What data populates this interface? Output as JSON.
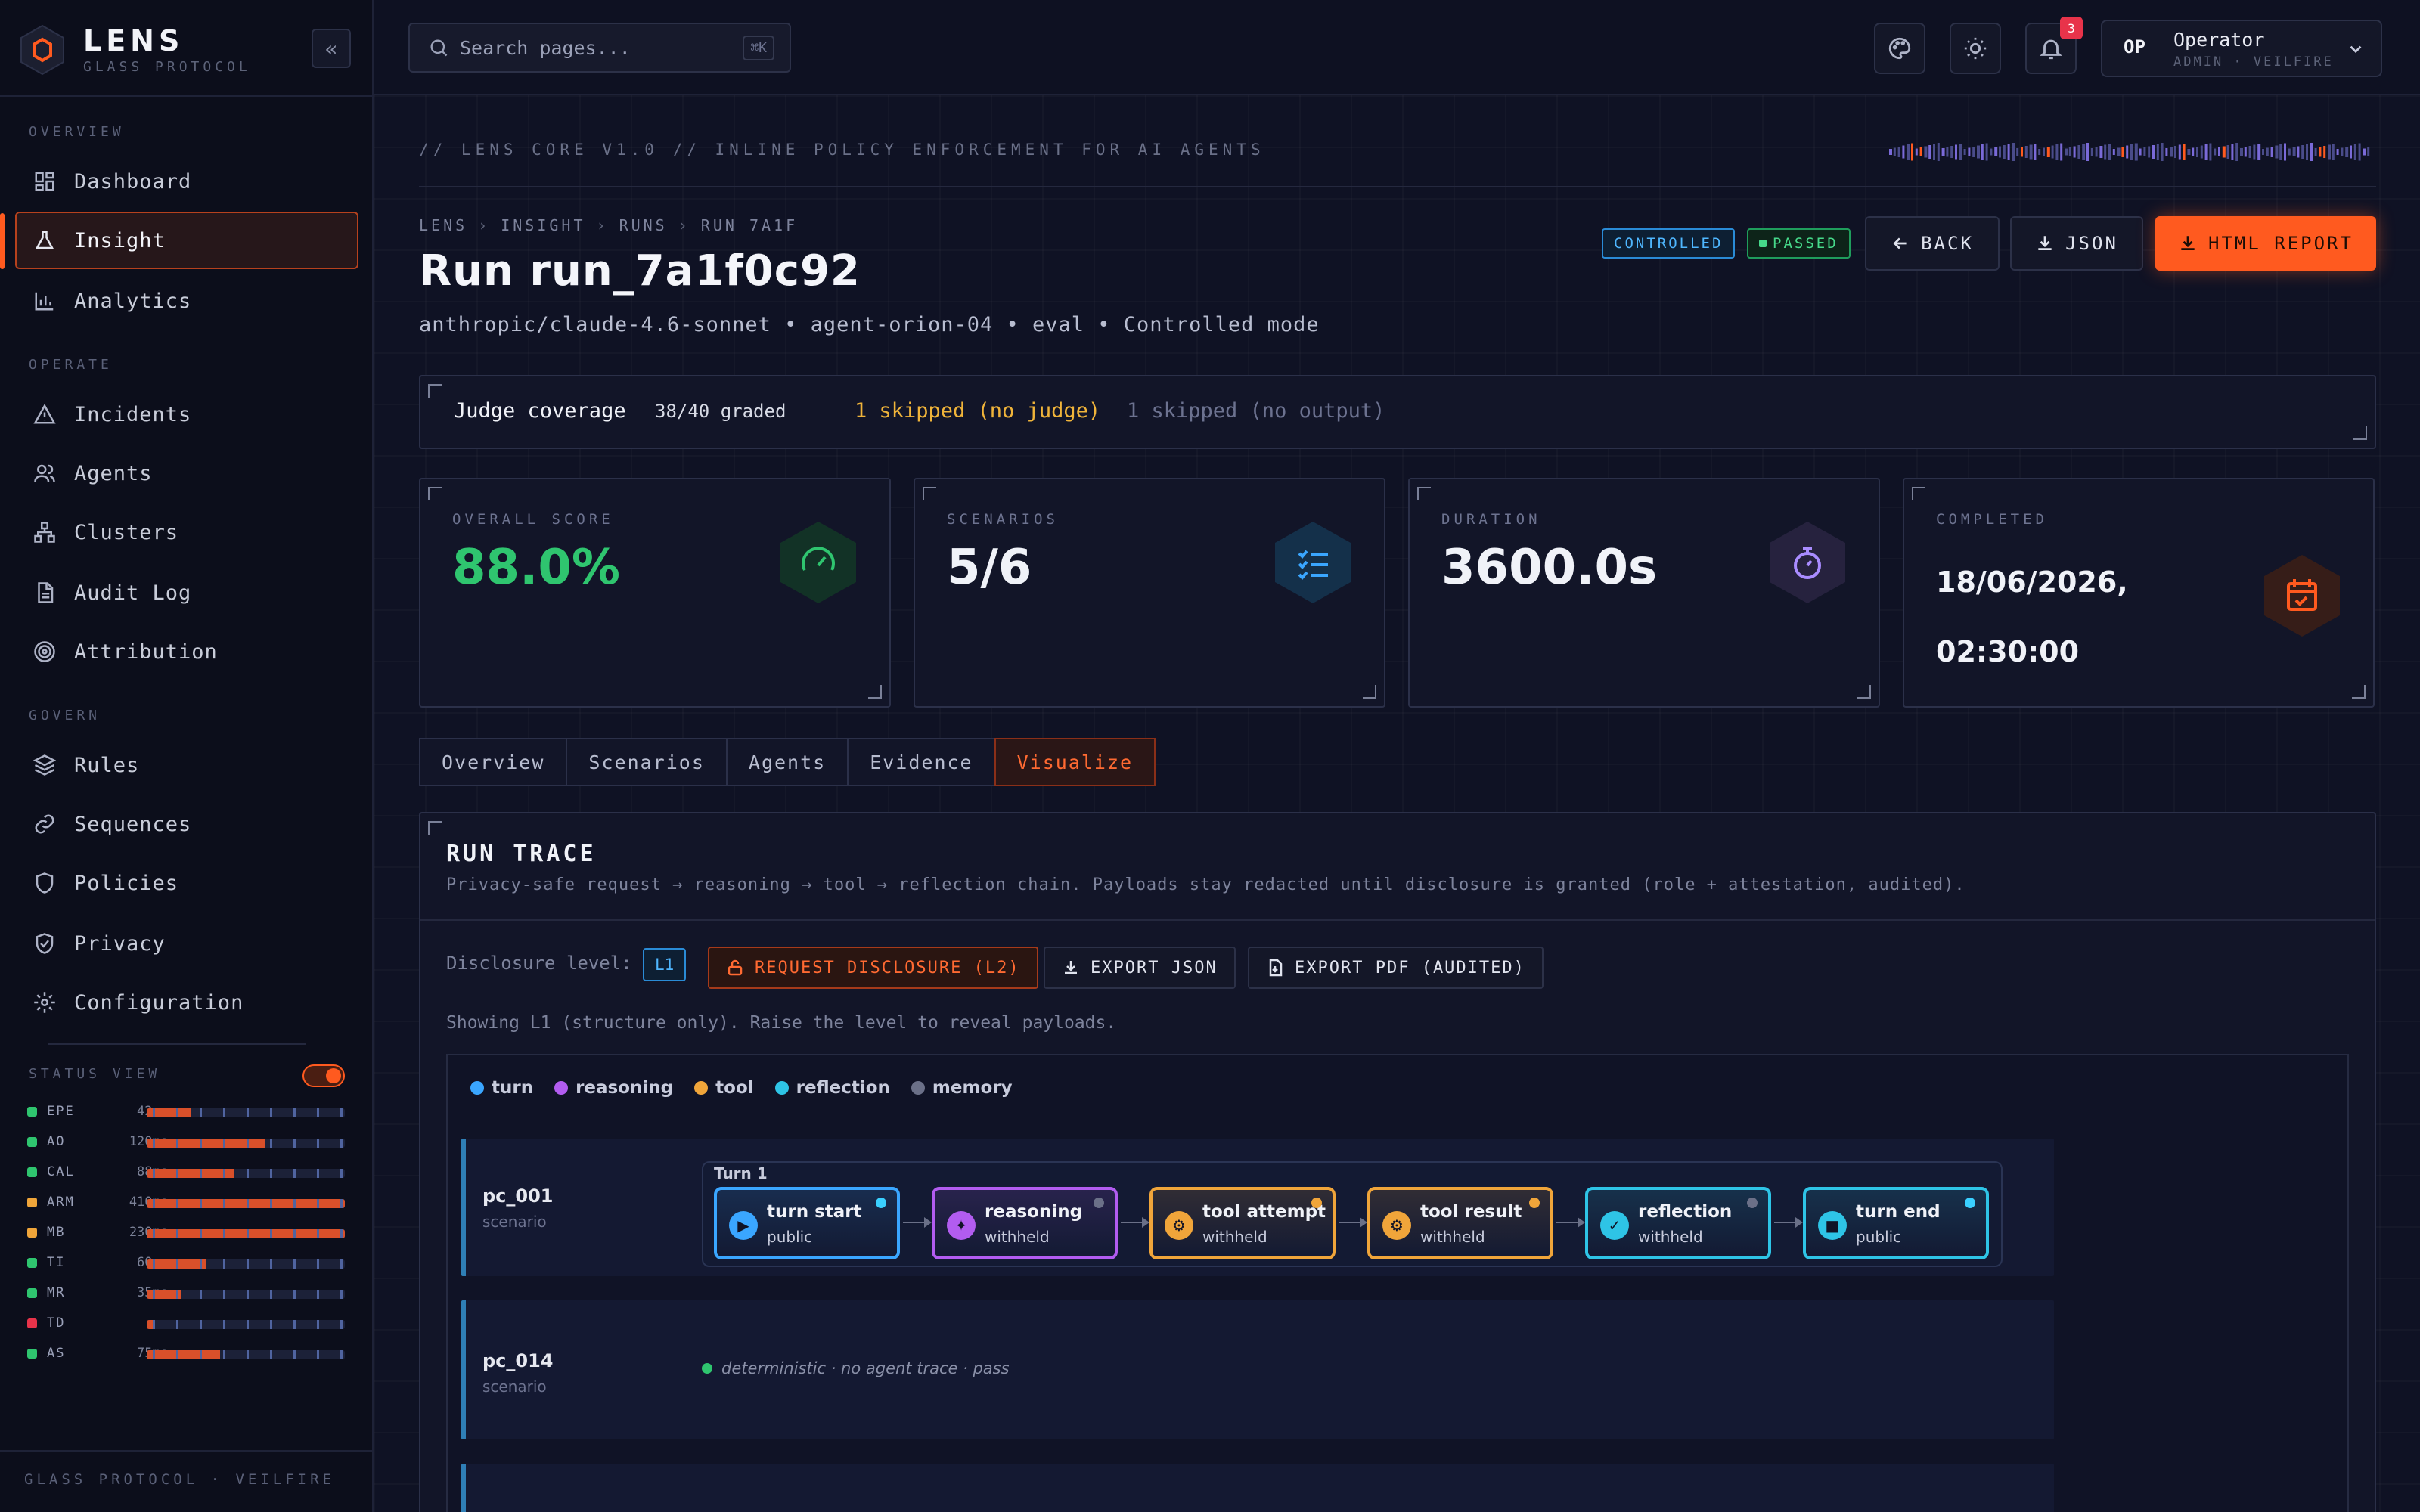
{
  "brand": {
    "name": "LENS",
    "sub": "GLASS PROTOCOL"
  },
  "sidebar": {
    "sections": [
      {
        "label": "OVERVIEW"
      },
      {
        "label": "OPERATE"
      },
      {
        "label": "GOVERN"
      }
    ],
    "items": [
      {
        "label": "Dashboard",
        "icon": "dashboard-icon"
      },
      {
        "label": "Insight",
        "icon": "flask-icon",
        "active": true
      },
      {
        "label": "Analytics",
        "icon": "bar-chart-icon"
      },
      {
        "label": "Incidents",
        "icon": "warning-icon"
      },
      {
        "label": "Agents",
        "icon": "users-icon"
      },
      {
        "label": "Clusters",
        "icon": "network-icon"
      },
      {
        "label": "Audit Log",
        "icon": "document-icon"
      },
      {
        "label": "Attribution",
        "icon": "target-icon"
      },
      {
        "label": "Rules",
        "icon": "layers-icon"
      },
      {
        "label": "Sequences",
        "icon": "link-icon"
      },
      {
        "label": "Policies",
        "icon": "shield-icon"
      },
      {
        "label": "Privacy",
        "icon": "shield-check-icon"
      },
      {
        "label": "Configuration",
        "icon": "gear-icon"
      }
    ],
    "status_view": {
      "label": "STATUS VIEW",
      "enabled": true,
      "rows": [
        {
          "code": "EPE",
          "latency": "42ms",
          "status": "ok",
          "color": "#2fc56f",
          "load": 0.22
        },
        {
          "code": "AO",
          "latency": "120ms",
          "status": "ok",
          "color": "#2fc56f",
          "load": 0.6
        },
        {
          "code": "CAL",
          "latency": "88ms",
          "status": "ok",
          "color": "#2fc56f",
          "load": 0.44
        },
        {
          "code": "ARM",
          "latency": "410ms",
          "status": "warn",
          "color": "#f0a53a",
          "load": 1.0
        },
        {
          "code": "MB",
          "latency": "230ms",
          "status": "warn",
          "color": "#f0a53a",
          "load": 1.0
        },
        {
          "code": "TI",
          "latency": "60ms",
          "status": "ok",
          "color": "#2fc56f",
          "load": 0.3
        },
        {
          "code": "MR",
          "latency": "35ms",
          "status": "ok",
          "color": "#2fc56f",
          "load": 0.17
        },
        {
          "code": "TD",
          "latency": "—",
          "status": "down",
          "color": "#e8334a",
          "load": 0.03
        },
        {
          "code": "AS",
          "latency": "75ms",
          "status": "ok",
          "color": "#2fc56f",
          "load": 0.37
        }
      ]
    },
    "footer": "GLASS PROTOCOL · VEILFIRE"
  },
  "header": {
    "search_placeholder": "Search pages...",
    "search_shortcut": "⌘K",
    "notifications_count": "3",
    "user": {
      "initials": "OP",
      "name": "Operator",
      "role": "ADMIN · VEILFIRE"
    }
  },
  "main": {
    "tagline": "// LENS CORE V1.0  //  INLINE POLICY ENFORCEMENT FOR AI AGENTS",
    "breadcrumb": [
      "LENS",
      "INSIGHT",
      "RUNS",
      "RUN_7A1F"
    ],
    "title": "Run run_7a1f0c92",
    "meta": "anthropic/claude-4.6-sonnet • agent-orion-04 • eval • Controlled mode",
    "badges": {
      "mode": "CONTROLLED",
      "result": "PASSED"
    },
    "actions": {
      "back": "BACK",
      "json": "JSON",
      "report": "HTML REPORT"
    },
    "coverage": {
      "label": "Judge coverage",
      "graded": "38/40 graded",
      "skipped_judge": "1 skipped (no judge)",
      "skipped_output": "1 skipped (no output)"
    },
    "stats": [
      {
        "label": "OVERALL SCORE",
        "value": "88.0%",
        "icon": "gauge-icon",
        "accent": "#2fc56f"
      },
      {
        "label": "SCENARIOS",
        "value": "5/6",
        "icon": "checklist-icon",
        "accent": "#3aa6ff"
      },
      {
        "label": "DURATION",
        "value": "3600.0s",
        "icon": "stopwatch-icon",
        "accent": "#a98cff"
      },
      {
        "label": "COMPLETED",
        "value": "18/06/2026,",
        "value2": "02:30:00",
        "icon": "calendar-icon",
        "accent": "#ff5a1f"
      }
    ],
    "tabs": [
      "Overview",
      "Scenarios",
      "Agents",
      "Evidence",
      "Visualize"
    ],
    "active_tab": "Visualize",
    "trace": {
      "title": "RUN TRACE",
      "subtitle": "Privacy-safe request → reasoning → tool → reflection chain. Payloads stay redacted until disclosure is granted (role + attestation, audited).",
      "disclosure_label": "Disclosure level:",
      "disclosure_level": "L1",
      "request_btn": "REQUEST DISCLOSURE (L2)",
      "export_json_btn": "EXPORT JSON",
      "export_pdf_btn": "EXPORT PDF (AUDITED)",
      "showing": "Showing L1 (structure only). Raise the level to reveal payloads.",
      "legend": [
        {
          "label": "turn",
          "color": "#3aa6ff"
        },
        {
          "label": "reasoning",
          "color": "#b25cf0"
        },
        {
          "label": "tool",
          "color": "#f0a53a"
        },
        {
          "label": "reflection",
          "color": "#2ec4e6"
        },
        {
          "label": "memory",
          "color": "#6b7088"
        }
      ],
      "lanes": [
        {
          "name": "pc_001",
          "kind": "scenario",
          "turn_label": "Turn 1",
          "nodes": [
            {
              "title": "turn start",
              "visibility": "public",
              "color": "#3aa6ff",
              "glyph": "▶",
              "dot": "#3ad0ff"
            },
            {
              "title": "reasoning",
              "visibility": "withheld",
              "color": "#b25cf0",
              "glyph": "✦",
              "dot": "#6b7088"
            },
            {
              "title": "tool attempt",
              "visibility": "withheld",
              "color": "#f0a53a",
              "glyph": "⚙",
              "dot": "#f0a53a"
            },
            {
              "title": "tool result",
              "visibility": "withheld",
              "color": "#f0a53a",
              "glyph": "⚙",
              "dot": "#f0a53a"
            },
            {
              "title": "reflection",
              "visibility": "withheld",
              "color": "#2ec4e6",
              "glyph": "✓",
              "dot": "#6b7088"
            },
            {
              "title": "turn end",
              "visibility": "public",
              "color": "#2ec4e6",
              "glyph": "■",
              "dot": "#3ad0ff"
            }
          ]
        },
        {
          "name": "pc_014",
          "kind": "scenario",
          "detail": "deterministic · no agent trace · pass"
        }
      ]
    }
  }
}
